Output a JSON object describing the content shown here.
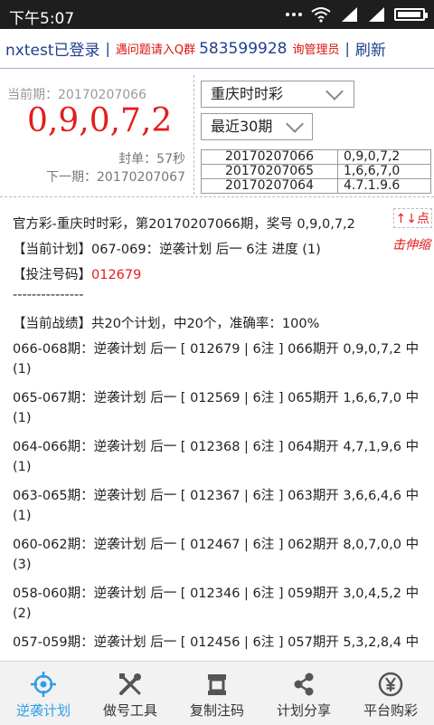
{
  "status": {
    "time": "下午5:07"
  },
  "header": {
    "user": "nxtest已登录",
    "hint": "遇问题请入Q群",
    "qq_group": "583599928",
    "admin": "询管理员",
    "refresh": "刷新"
  },
  "draw": {
    "current_label": "当前期：20170207066",
    "current_numbers": "0,9,0,7,2",
    "seal": "封单：57秒",
    "next": "下一期：20170207067",
    "lottery_select": "重庆时时彩",
    "range_select": "最近30期",
    "history": [
      {
        "issue": "20170207066",
        "numbers": "0,9,0,7,2"
      },
      {
        "issue": "20170207065",
        "numbers": "1,6,6,7,0"
      },
      {
        "issue": "20170207064",
        "numbers": "4.7.1.9.6"
      }
    ]
  },
  "content": {
    "arrows": "↑↓点",
    "stretch": "击伸缩",
    "line1": "官方彩-重庆时时彩，第20170207066期，奖号 0,9,0,7,2",
    "plan": "【当前计划】067-069：逆袭计划 后一 6注 进度 (1)",
    "bet_label": "【投注号码】",
    "bet_numbers": "012679",
    "divider": "---------------",
    "record": "【当前战绩】共20个计划，中20个，准确率：100%",
    "records": [
      {
        "line": "066-068期：逆袭计划 后一 [ 012679 | 6注 ] 066期开 0,9,0,7,2 中",
        "cont": "(1)"
      },
      {
        "line": "065-067期：逆袭计划 后一 [ 012569 | 6注 ] 065期开 1,6,6,7,0 中",
        "cont": "(1)"
      },
      {
        "line": "064-066期：逆袭计划 后一 [ 012368 | 6注 ] 064期开 4,7,1,9,6 中",
        "cont": "(1)"
      },
      {
        "line": "063-065期：逆袭计划 后一 [ 012367 | 6注 ] 063期开 3,6,6,4,6 中",
        "cont": "(1)"
      },
      {
        "line": "060-062期：逆袭计划 后一 [ 012467 | 6注 ] 062期开 8,0,7,0,0 中",
        "cont": "(3)"
      },
      {
        "line": "058-060期：逆袭计划 后一 [ 012346 | 6注 ] 059期开 3,0,4,5,2 中",
        "cont": "(2)"
      },
      {
        "line": "057-059期：逆袭计划 后一 [ 012456 | 6注 ] 057期开 5,3,2,8,4 中",
        "cont": ""
      }
    ]
  },
  "tabs": [
    {
      "label": "逆袭计划",
      "icon": "crosshair-icon",
      "active": true
    },
    {
      "label": "做号工具",
      "icon": "tools-icon",
      "active": false
    },
    {
      "label": "复制注码",
      "icon": "copy-icon",
      "active": false
    },
    {
      "label": "计划分享",
      "icon": "share-icon",
      "active": false
    },
    {
      "label": "平台购彩",
      "icon": "yen-icon",
      "active": false
    }
  ],
  "colors": {
    "accent": "#2e9ee6",
    "red": "#e41c1c",
    "link": "#1f3f8f"
  }
}
